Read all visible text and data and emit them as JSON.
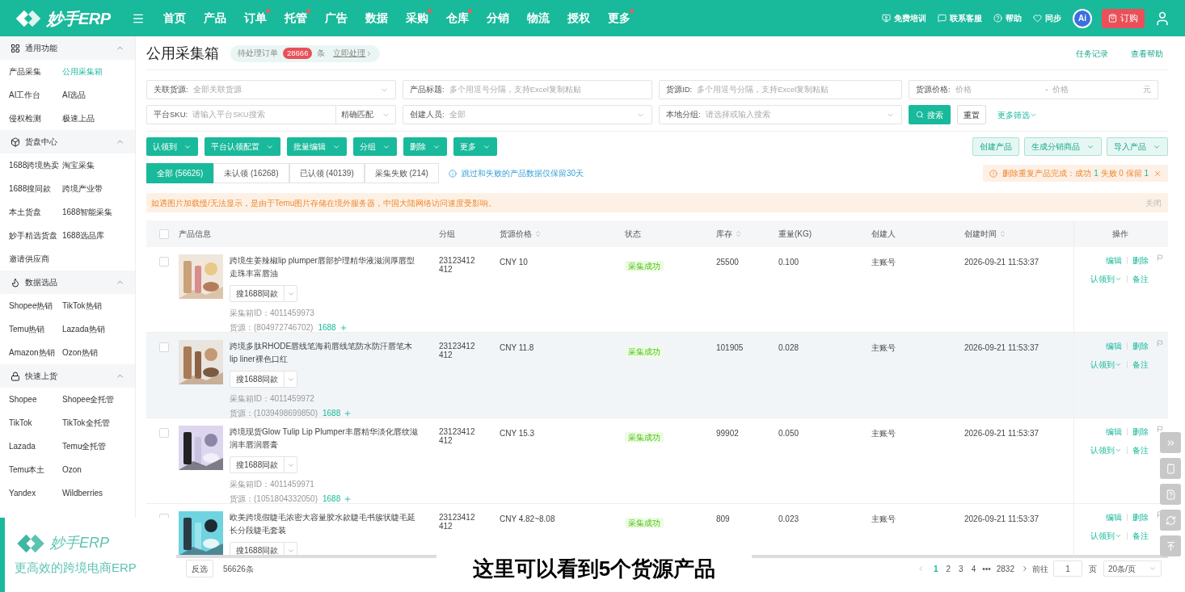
{
  "header": {
    "brand": "妙手ERP",
    "nav": [
      {
        "label": "首页",
        "dot": false
      },
      {
        "label": "产品",
        "dot": false
      },
      {
        "label": "订单",
        "dot": true
      },
      {
        "label": "托管",
        "dot": true
      },
      {
        "label": "广告",
        "dot": false
      },
      {
        "label": "数据",
        "dot": false
      },
      {
        "label": "采购",
        "dot": true
      },
      {
        "label": "仓库",
        "dot": true
      },
      {
        "label": "分销",
        "dot": false
      },
      {
        "label": "物流",
        "dot": false
      },
      {
        "label": "授权",
        "dot": false
      },
      {
        "label": "更多",
        "dot": true
      }
    ],
    "utilities": [
      "免费培训",
      "联系客服",
      "帮助",
      "同步"
    ],
    "ai_badge": "Ai",
    "order_button": "订购"
  },
  "sidebar": {
    "sections": [
      {
        "title": "通用功能",
        "expanded": true,
        "items": [
          {
            "label": "产品采集",
            "selected": false
          },
          {
            "label": "公用采集箱",
            "selected": true
          },
          {
            "label": "AI工作台",
            "selected": false
          },
          {
            "label": "AI选品",
            "selected": false
          },
          {
            "label": "侵权检测",
            "selected": false
          },
          {
            "label": "极速上品",
            "selected": false
          }
        ]
      },
      {
        "title": "货盘中心",
        "expanded": true,
        "items": [
          {
            "label": "1688跨境热卖",
            "selected": false
          },
          {
            "label": "淘宝采集",
            "selected": false
          },
          {
            "label": "1688搜同款",
            "selected": false
          },
          {
            "label": "跨境产业带",
            "selected": false
          },
          {
            "label": "本土货盘",
            "selected": false
          },
          {
            "label": "1688智能采集",
            "selected": false
          },
          {
            "label": "妙手精选货盘",
            "selected": false
          },
          {
            "label": "1688选品库",
            "selected": false
          },
          {
            "label": "邀请供应商",
            "selected": false
          }
        ]
      },
      {
        "title": "数据选品",
        "expanded": true,
        "items": [
          {
            "label": "Shopee热销",
            "selected": false
          },
          {
            "label": "TikTok热销",
            "selected": false
          },
          {
            "label": "Temu热销",
            "selected": false
          },
          {
            "label": "Lazada热销",
            "selected": false
          },
          {
            "label": "Amazon热销",
            "selected": false
          },
          {
            "label": "Ozon热销",
            "selected": false
          }
        ]
      },
      {
        "title": "快速上货",
        "expanded": true,
        "items": [
          {
            "label": "Shopee",
            "selected": false
          },
          {
            "label": "Shopee全托管",
            "selected": false
          },
          {
            "label": "TikTok",
            "selected": false
          },
          {
            "label": "TikTok全托管",
            "selected": false
          },
          {
            "label": "Lazada",
            "selected": false
          },
          {
            "label": "Temu全托管",
            "selected": false
          },
          {
            "label": "Temu本土",
            "selected": false
          },
          {
            "label": "Ozon",
            "selected": false
          },
          {
            "label": "Yandex",
            "selected": false
          },
          {
            "label": "Wildberries",
            "selected": false
          }
        ]
      }
    ]
  },
  "page": {
    "title": "公用采集箱",
    "pending": {
      "label": "待处理订单",
      "count": "28666",
      "unit": "条",
      "link": "立即处理"
    },
    "links": [
      "任务记录",
      "查看帮助"
    ]
  },
  "filters": {
    "row_1": [
      {
        "kind": "select",
        "label": "关联货源:",
        "placeholder": "全部关联货源"
      },
      {
        "kind": "text",
        "label": "产品标题:",
        "placeholder": "多个用逗号分隔，支持Excel复制粘贴"
      },
      {
        "kind": "text",
        "label": "货源ID:",
        "placeholder": "多个用逗号分隔，支持Excel复制粘贴"
      },
      {
        "kind": "range",
        "label": "货源价格:",
        "placeholder": "价格",
        "placeholder_2": "价格",
        "separator": "-",
        "unit": "元"
      }
    ],
    "row_2": [
      {
        "kind": "text",
        "label": "平台SKU:",
        "placeholder": "请输入平台SKU搜索",
        "match": "精确匹配"
      },
      {
        "kind": "select",
        "label": "创建人员:",
        "placeholder": "全部"
      },
      {
        "kind": "select",
        "label": "本地分组:",
        "placeholder": "请选择或输入搜索"
      }
    ],
    "search_button": "搜索",
    "reset_button": "重置",
    "more_filters": "更多筛选"
  },
  "toolbar": {
    "left": [
      "认领到",
      "平台认领配置",
      "批量编辑",
      "分组",
      "删除",
      "更多"
    ],
    "right": [
      {
        "label": "创建产品",
        "dropdown": false
      },
      {
        "label": "生成分销商品",
        "dropdown": true
      },
      {
        "label": "导入产品",
        "dropdown": true
      }
    ]
  },
  "tabs": [
    {
      "label": "全部 (56626)",
      "selected": true
    },
    {
      "label": "未认领 (16268)",
      "selected": false
    },
    {
      "label": "已认领 (40139)",
      "selected": false
    },
    {
      "label": "采集失败 (214)",
      "selected": false
    }
  ],
  "tab_note": "跳过和失败的产品数据仅保留30天",
  "result": {
    "prefix": "删除重复产品完成：",
    "items": [
      {
        "label": "成功",
        "count": "1",
        "kind": "ok"
      },
      {
        "label": "失败",
        "count": "0",
        "kind": "fail"
      },
      {
        "label": "保留",
        "count": "1",
        "kind": "ok"
      }
    ]
  },
  "banner": {
    "text": "如遇图片加载慢/无法显示，是由于Temu图片存储在境外服务器，中国大陆网络访问速度受影响。",
    "close": "关闭"
  },
  "table": {
    "columns": [
      {
        "label": "产品信息",
        "sortable": false
      },
      {
        "label": "分组",
        "sortable": false
      },
      {
        "label": "货源价格",
        "sortable": true
      },
      {
        "label": "状态",
        "sortable": false
      },
      {
        "label": "库存",
        "sortable": true
      },
      {
        "label": "重量(KG)",
        "sortable": false
      },
      {
        "label": "创建人",
        "sortable": false
      },
      {
        "label": "创建时间",
        "sortable": true
      },
      {
        "label": "操作",
        "sortable": false
      }
    ],
    "header_checked": false,
    "rows": [
      {
        "checked": false,
        "highlighted": false,
        "title": "跨境生姜辣椒lip plumper唇部护理精华液滋润厚唇型走珠丰富唇油",
        "search": "搜1688同款",
        "box_id": "采集箱ID：4011459973",
        "source": "货源：(804972746702)",
        "source_link": "1688",
        "group": "23123412412",
        "price": "CNY 10",
        "status": "采集成功",
        "stock": "25500",
        "weight": "0.100",
        "creator": "主账号",
        "created": "2026-09-21 11:53:37",
        "actions": [
          "编辑",
          "删除",
          "认领到",
          "备注"
        ]
      },
      {
        "checked": false,
        "highlighted": true,
        "title": "跨境多肽RHODE唇线笔海莉唇线笔防水防汗唇笔木lip liner裸色口红",
        "search": "搜1688同款",
        "box_id": "采集箱ID：4011459972",
        "source": "货源：(1039498699850)",
        "source_link": "1688",
        "group": "23123412412",
        "price": "CNY 11.8",
        "status": "采集成功",
        "stock": "101905",
        "weight": "0.028",
        "creator": "主账号",
        "created": "2026-09-21 11:53:37",
        "actions": [
          "编辑",
          "删除",
          "认领到",
          "备注"
        ]
      },
      {
        "checked": false,
        "highlighted": false,
        "title": "跨境现货Glow Tulip Lip Plumper丰唇精华淡化唇纹滋润丰唇润唇膏",
        "search": "搜1688同款",
        "box_id": "采集箱ID：4011459971",
        "source": "货源：(1051804332050)",
        "source_link": "1688",
        "group": "23123412412",
        "price": "CNY 15.3",
        "status": "采集成功",
        "stock": "99902",
        "weight": "0.050",
        "creator": "主账号",
        "created": "2026-09-21 11:53:37",
        "actions": [
          "编辑",
          "删除",
          "认领到",
          "备注"
        ]
      },
      {
        "checked": false,
        "highlighted": false,
        "title": "欧美跨境假睫毛浓密大容量胶水款睫毛书簇状睫毛延长分段睫毛套装",
        "search": "搜1688同款",
        "group": "23123412412",
        "price": "CNY 4.82~8.08",
        "status": "采集成功",
        "stock": "809",
        "weight": "0.023",
        "creator": "主账号",
        "created": "2026-09-21 11:53:37",
        "actions": [
          "编辑",
          "删除",
          "认领到",
          "备注"
        ]
      }
    ]
  },
  "footer": {
    "invert": "反选",
    "total": "56626条",
    "pages": [
      {
        "label": "1",
        "selected": true
      },
      {
        "label": "2",
        "selected": false
      },
      {
        "label": "3",
        "selected": false
      },
      {
        "label": "4",
        "selected": false
      }
    ],
    "ellipsis": "•••",
    "last": "2832",
    "goto": "前往",
    "goto_value": "1",
    "page_unit": "页",
    "page_size": "20条/页"
  },
  "overlay": {
    "brand": "妙手ERP",
    "slogan": "更高效的跨境电商ERP",
    "caption": "这里可以看到5个货源产品"
  }
}
